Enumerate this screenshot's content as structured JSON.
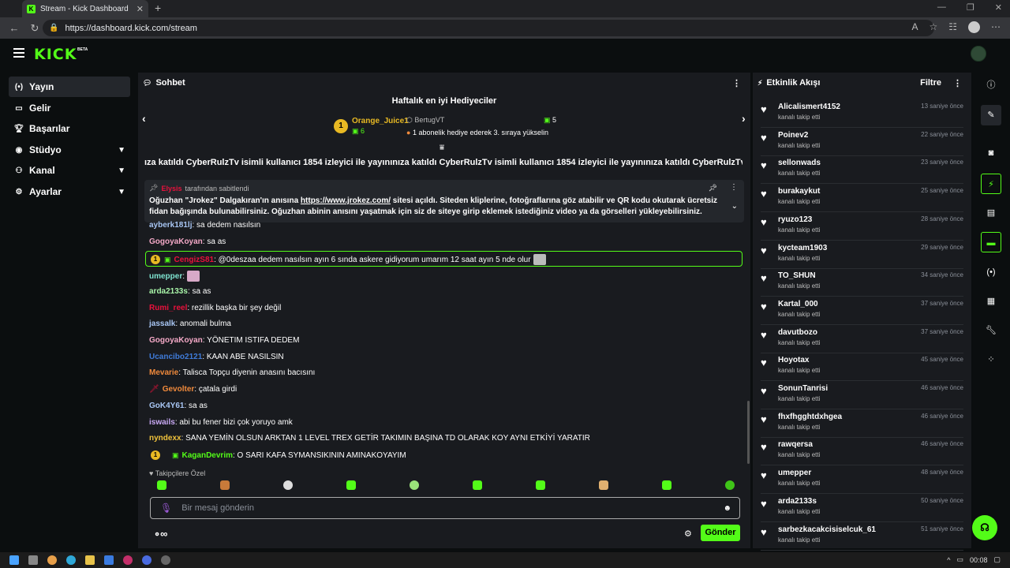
{
  "browser": {
    "tab_title": "Stream - Kick Dashboard",
    "url": "https://dashboard.kick.com/stream"
  },
  "header": {
    "logo": "KICK",
    "beta": "BETA"
  },
  "sidebar": {
    "items": [
      {
        "label": "Yayın",
        "icon": "broadcast-icon"
      },
      {
        "label": "Gelir",
        "icon": "money-icon"
      },
      {
        "label": "Başarılar",
        "icon": "trophy-icon"
      },
      {
        "label": "Stüdyo",
        "icon": "studio-icon"
      },
      {
        "label": "Kanal",
        "icon": "channel-icon"
      },
      {
        "label": "Ayarlar",
        "icon": "settings-icon"
      }
    ]
  },
  "chat": {
    "title": "Sohbet",
    "top_gifters": {
      "title": "Haftalık en iyi Hediyeciler",
      "first": {
        "rank": "1",
        "name": "Orange_Juice1",
        "count": "6"
      },
      "second": {
        "name": "BertugVT",
        "count": "5",
        "hint": "1 abonelik hediye ederek 3. sıraya yükselin"
      }
    },
    "ticker": "ıza katıldı CyberRulzTv isimli kullanıcı 1854 izleyici ile yayınınıza katıldı CyberRulzTv isimli kullanıcı 1854 izleyici ile yayınınıza katıldı CyberRulzTv isimli kullanı",
    "pinned": {
      "by_user": "Elysis",
      "by_text": "tarafından sabitlendi",
      "text_before": "Oğuzhan \"Jrokez\" Dalgakıran'ın anısına ",
      "link": "https://www.jrokez.com/",
      "text_after": " sitesi açıldı. Siteden kliplerine, fotoğraflarına göz atabilir ve QR kodu okutarak ücretsiz fidan bağışında bulunabilirsiniz. Oğuzhan abinin anısını yaşatmak için siz de siteye girip eklemek istediğiniz video ya da görselleri yükleyebilirsiniz."
    },
    "messages": [
      {
        "user": "ayberk181lj",
        "color": "#a9c7f5",
        "text": ": sa dedem nasılsın"
      },
      {
        "user": "GogoyaKoyan",
        "color": "#f4a9c7",
        "text": ": sa as"
      },
      {
        "user": "CengizS81",
        "color": "#e9113c",
        "text": ": @0deszaa dedem nasılsın ayın 6 sında askere gidiyorum umarım 12 saat ayın 5 nde olur"
      },
      {
        "user": "umepper",
        "color": "#7fe3d0",
        "text": ":"
      },
      {
        "user": "arda2133s",
        "color": "#a9f5a9",
        "text": ": sa as"
      },
      {
        "user": "Rumi_reel",
        "color": "#e9113c",
        "text": ": rezillik başka bir şey değil"
      },
      {
        "user": "jassalk",
        "color": "#a9c7f5",
        "text": ": anomali bulma"
      },
      {
        "user": "GogoyaKoyan",
        "color": "#f4a9c7",
        "text": ": YÖNETIM ISTIFA DEDEM"
      },
      {
        "user": "Ucancibo2121",
        "color": "#3f7bd9",
        "text": ": KAAN ABE NASILSIN"
      },
      {
        "user": "Mevarie",
        "color": "#f08a3c",
        "text": ": Talisca Topçu diyenin anasını bacısını"
      },
      {
        "user": "Gevolter",
        "color": "#f08a3c",
        "text": ": çatala girdi"
      },
      {
        "user": "GoK4Y61",
        "color": "#a9c7f5",
        "text": ": sa as"
      },
      {
        "user": "iswails",
        "color": "#c9a9f5",
        "text": ": abi bu fener bizi çok yoruyo amk"
      },
      {
        "user": "nyndexx",
        "color": "#f0c23c",
        "text": ": SANA YEMİN OLSUN ARKTAN 1 LEVEL TREX GETİR TAKIMIN BAŞINA TD OLARAK KOY AYNI ETKİYİ YARATIR"
      },
      {
        "user": "KaganDevrim",
        "color": "#53fc18",
        "text": ": O SARI KAFA SYMANSIKININ AMINAKOYAYIM"
      }
    ],
    "follow_only": "Takipçilere Özel",
    "input_placeholder": "Bir mesaj gönderin",
    "send_label": "Gönder"
  },
  "activity": {
    "title": "Etkinlik Akışı",
    "filter_label": "Filtre",
    "items": [
      {
        "name": "Alicalismert4152",
        "event": "kanalı takip etti",
        "time": "13 saniye önce"
      },
      {
        "name": "Poinev2",
        "event": "kanalı takip etti",
        "time": "22 saniye önce"
      },
      {
        "name": "sellonwads",
        "event": "kanalı takip etti",
        "time": "23 saniye önce"
      },
      {
        "name": "burakaykut",
        "event": "kanalı takip etti",
        "time": "25 saniye önce"
      },
      {
        "name": "ryuzo123",
        "event": "kanalı takip etti",
        "time": "28 saniye önce"
      },
      {
        "name": "kycteam1903",
        "event": "kanalı takip etti",
        "time": "29 saniye önce"
      },
      {
        "name": "TO_SHUN",
        "event": "kanalı takip etti",
        "time": "34 saniye önce"
      },
      {
        "name": "Kartal_000",
        "event": "kanalı takip etti",
        "time": "37 saniye önce"
      },
      {
        "name": "davutbozo",
        "event": "kanalı takip etti",
        "time": "37 saniye önce"
      },
      {
        "name": "Hoyotax",
        "event": "kanalı takip etti",
        "time": "45 saniye önce"
      },
      {
        "name": "SonunTanrisi",
        "event": "kanalı takip etti",
        "time": "46 saniye önce"
      },
      {
        "name": "fhxfhgghtdxhgea",
        "event": "kanalı takip etti",
        "time": "46 saniye önce"
      },
      {
        "name": "rawqersa",
        "event": "kanalı takip etti",
        "time": "46 saniye önce"
      },
      {
        "name": "umepper",
        "event": "kanalı takip etti",
        "time": "48 saniye önce"
      },
      {
        "name": "arda2133s",
        "event": "kanalı takip etti",
        "time": "50 saniye önce"
      },
      {
        "name": "sarbezkacakcisiselcuk_61",
        "event": "kanalı takip etti",
        "time": "51 saniye önce"
      }
    ]
  },
  "taskbar": {
    "time": "00:08"
  },
  "colors": {
    "accent": "#53fc18",
    "panel": "#191b1f",
    "background": "#0b0e0f"
  }
}
